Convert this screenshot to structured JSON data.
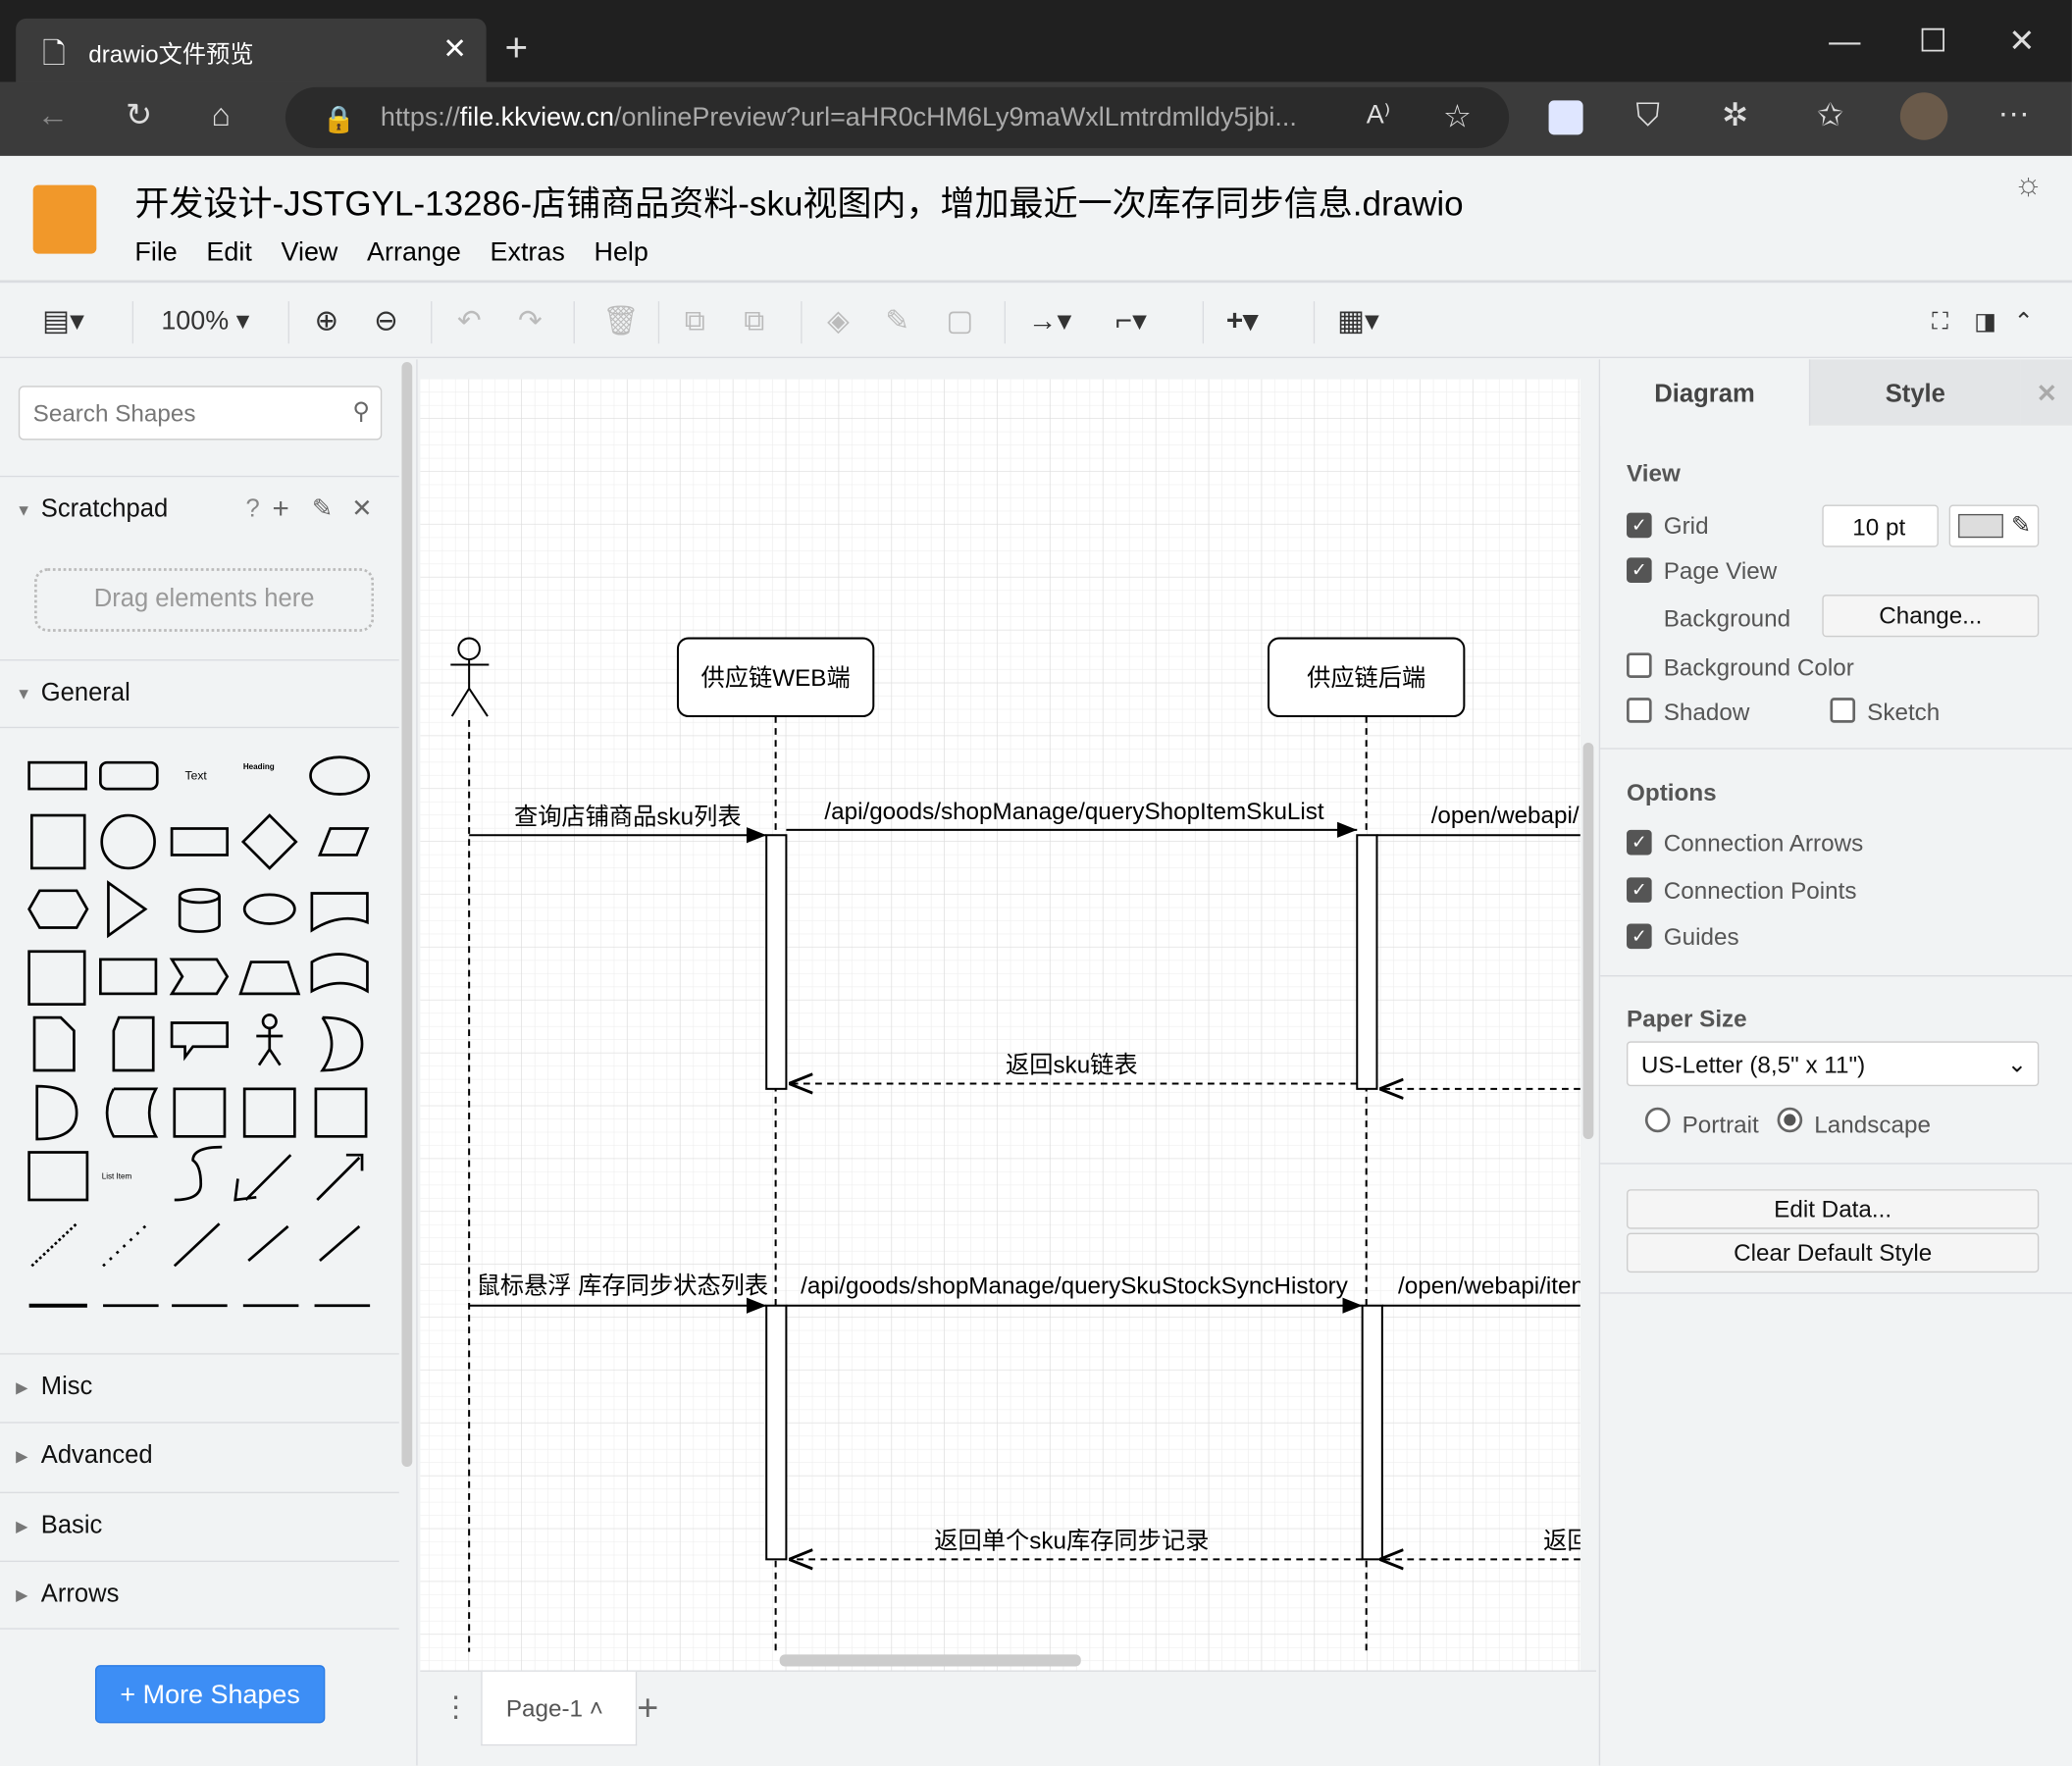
{
  "browser": {
    "tab_title": "drawio文件预览",
    "url_prefix": "https://",
    "url_host": "file.kkview.cn",
    "url_rest": "/onlinePreview?url=aHR0cHM6Ly9maWxlLmtrdmlldy5jbi..."
  },
  "app": {
    "title": "开发设计-JSTGYL-13286-店铺商品资料-sku视图内，增加最近一次库存同步信息.drawio",
    "menu": [
      "File",
      "Edit",
      "View",
      "Arrange",
      "Extras",
      "Help"
    ],
    "zoom": "100%",
    "brand_color": "#f1982a"
  },
  "sidebar": {
    "search_placeholder": "Search Shapes",
    "scratchpad": "Scratchpad",
    "scratchpad_help": "?",
    "drag_hint": "Drag elements here",
    "general": "General",
    "shape_text": "Text",
    "shape_heading": "Heading",
    "shape_list": "List",
    "shape_list_item": "List Item",
    "sections": [
      "Misc",
      "Advanced",
      "Basic",
      "Arrows"
    ],
    "more_shapes": "More Shapes"
  },
  "diagram": {
    "participants": [
      "供应链WEB端",
      "供应链后端"
    ],
    "messages": [
      "查询店铺商品sku列表",
      "/api/goods/shopManage/queryShopItemSkuList",
      "/open/webapi/",
      "返回sku链表",
      "鼠标悬浮 库存同步状态列表",
      "/api/goods/shopManage/querySkuStockSyncHistory",
      "/open/webapi/iten",
      "返回单个sku库存同步记录",
      "返回"
    ]
  },
  "pages": {
    "current": "Page-1"
  },
  "panel": {
    "tabs": [
      "Diagram",
      "Style"
    ],
    "view": "View",
    "grid": "Grid",
    "grid_size": "10 pt",
    "page_view": "Page View",
    "background": "Background",
    "change": "Change...",
    "background_color": "Background Color",
    "shadow": "Shadow",
    "sketch": "Sketch",
    "options": "Options",
    "connection_arrows": "Connection Arrows",
    "connection_points": "Connection Points",
    "guides": "Guides",
    "paper_size": "Paper Size",
    "paper_value": "US-Letter (8,5\" x 11\")",
    "portrait": "Portrait",
    "landscape": "Landscape",
    "edit_data": "Edit Data...",
    "clear_style": "Clear Default Style",
    "checked": {
      "grid": true,
      "page_view": true,
      "background_color": false,
      "shadow": false,
      "sketch": false,
      "connection_arrows": true,
      "connection_points": true,
      "guides": true,
      "landscape": true
    }
  }
}
